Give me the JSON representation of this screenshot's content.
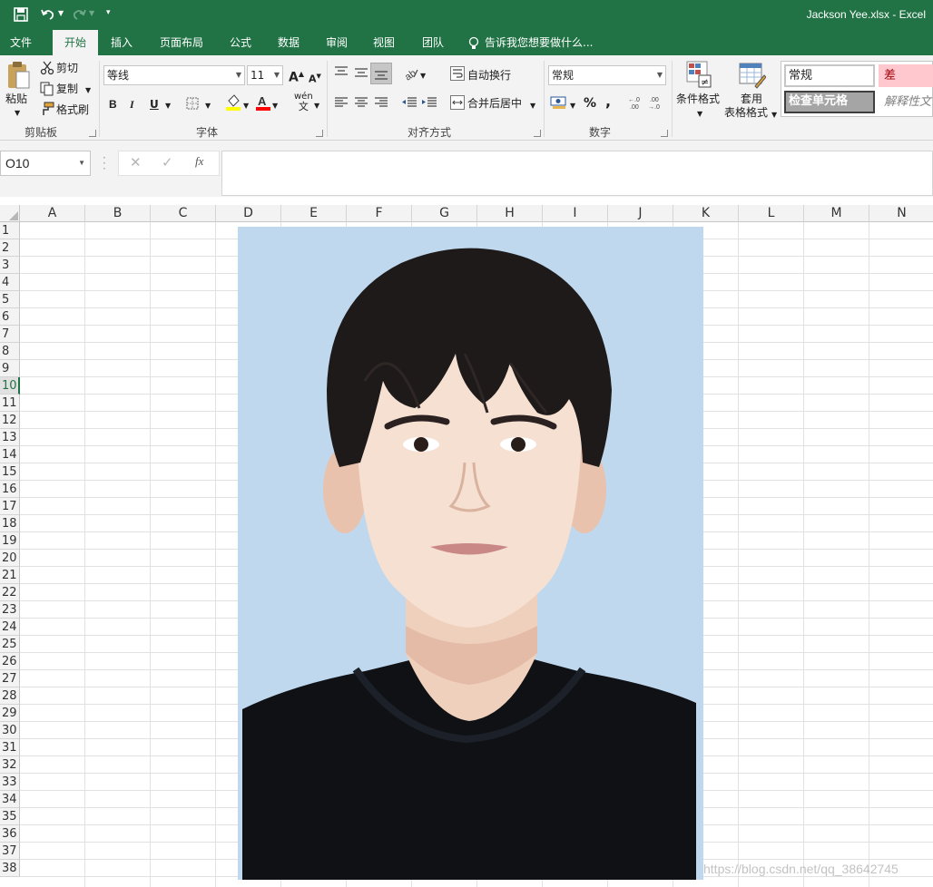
{
  "title": "Jackson Yee.xlsx  -  Excel",
  "tabs": [
    "文件",
    "开始",
    "插入",
    "页面布局",
    "公式",
    "数据",
    "审阅",
    "视图",
    "团队"
  ],
  "tell_me": "告诉我您想要做什么...",
  "clipboard": {
    "paste": "粘贴",
    "cut": "剪切",
    "copy": "复制",
    "format_painter": "格式刷",
    "label": "剪贴板"
  },
  "font": {
    "name": "等线",
    "size": "11",
    "label": "字体",
    "bold": "B",
    "italic": "I",
    "underline": "U",
    "wen": "wén",
    "grow": "A",
    "shrink": "A"
  },
  "alignment": {
    "wrap": "自动换行",
    "merge": "合并后居中",
    "label": "对齐方式"
  },
  "number": {
    "format": "常规",
    "percent": "%",
    "comma": ",",
    "label": "数字",
    "inc_decimal": ".0 .00",
    "dec_decimal": ".00 .0"
  },
  "styles": {
    "conditional": "条件格式",
    "table_format_1": "套用",
    "table_format_2": "表格格式",
    "normal": "常规",
    "bad": "差",
    "check_cell": "检查单元格",
    "explanatory": "解释性文"
  },
  "formula_bar": {
    "name_box": "O10",
    "cancel": "✕",
    "enter": "✓",
    "fx": "fx",
    "content": ""
  },
  "columns": [
    "A",
    "B",
    "C",
    "D",
    "E",
    "F",
    "G",
    "H",
    "I",
    "J",
    "K",
    "L",
    "M",
    "N"
  ],
  "rows": [
    "1",
    "2",
    "3",
    "4",
    "5",
    "6",
    "7",
    "8",
    "9",
    "10",
    "11",
    "12",
    "13",
    "14",
    "15",
    "16",
    "17",
    "18",
    "19",
    "20",
    "21",
    "22",
    "23",
    "24",
    "25",
    "26",
    "27",
    "28",
    "29",
    "30",
    "31",
    "32",
    "33",
    "34",
    "35",
    "36",
    "37",
    "38"
  ],
  "active_row": "10",
  "watermark": "https://blog.csdn.net/qq_38642745",
  "colors": {
    "excel_green": "#217346",
    "photo_bg": "#bfd8ee",
    "bad_fill": "#ffc7ce",
    "bad_text": "#9c0006"
  }
}
